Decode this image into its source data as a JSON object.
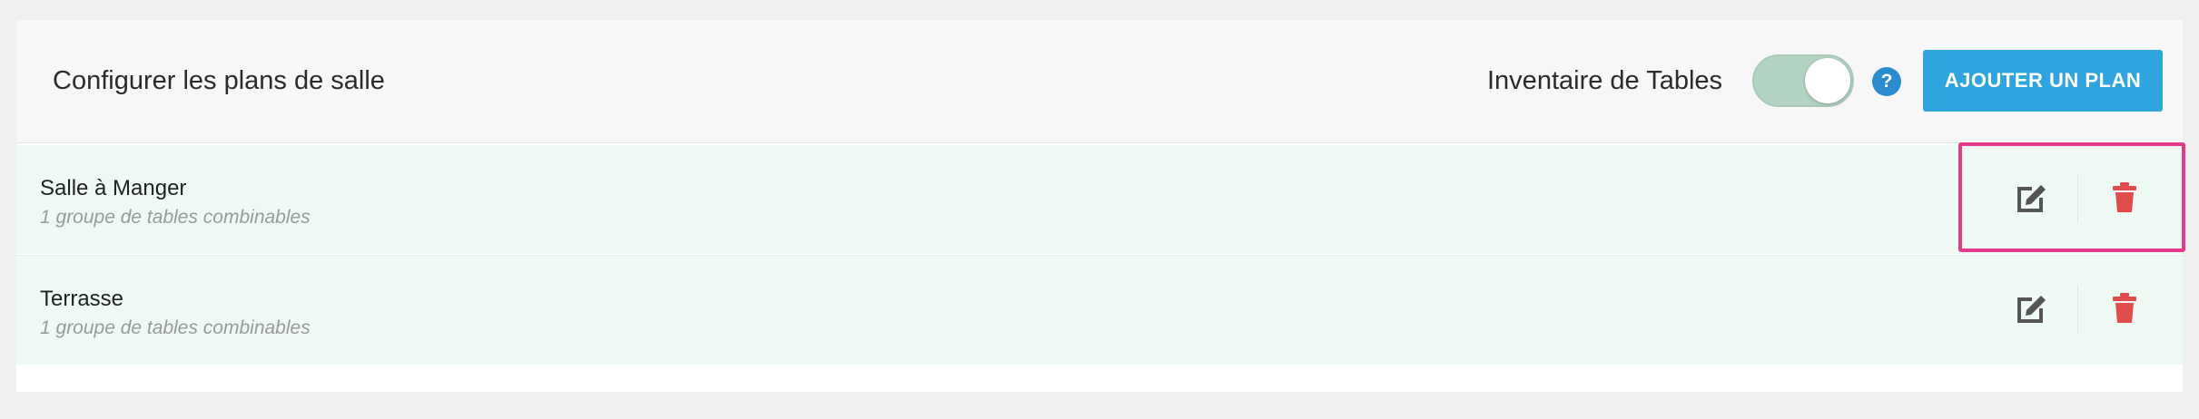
{
  "header": {
    "title": "Configurer les plans de salle",
    "toggle_label": "Inventaire de Tables",
    "toggle_on": true,
    "help_symbol": "?",
    "add_button_label": "AJOUTER UN PLAN"
  },
  "plans": [
    {
      "name": "Salle à Manger",
      "subtitle": "1 groupe de tables combinables",
      "edit_icon": "edit-icon",
      "delete_icon": "trash-icon"
    },
    {
      "name": "Terrasse",
      "subtitle": "1 groupe de tables combinables",
      "edit_icon": "edit-icon",
      "delete_icon": "trash-icon"
    }
  ],
  "colors": {
    "accent": "#2fa4de",
    "help": "#2a8ccf",
    "toggle": "#b3d3c3",
    "row_bg": "#edf9f2",
    "delete": "#e04b4b",
    "edit": "#555555",
    "highlight": "#e53a8b"
  }
}
